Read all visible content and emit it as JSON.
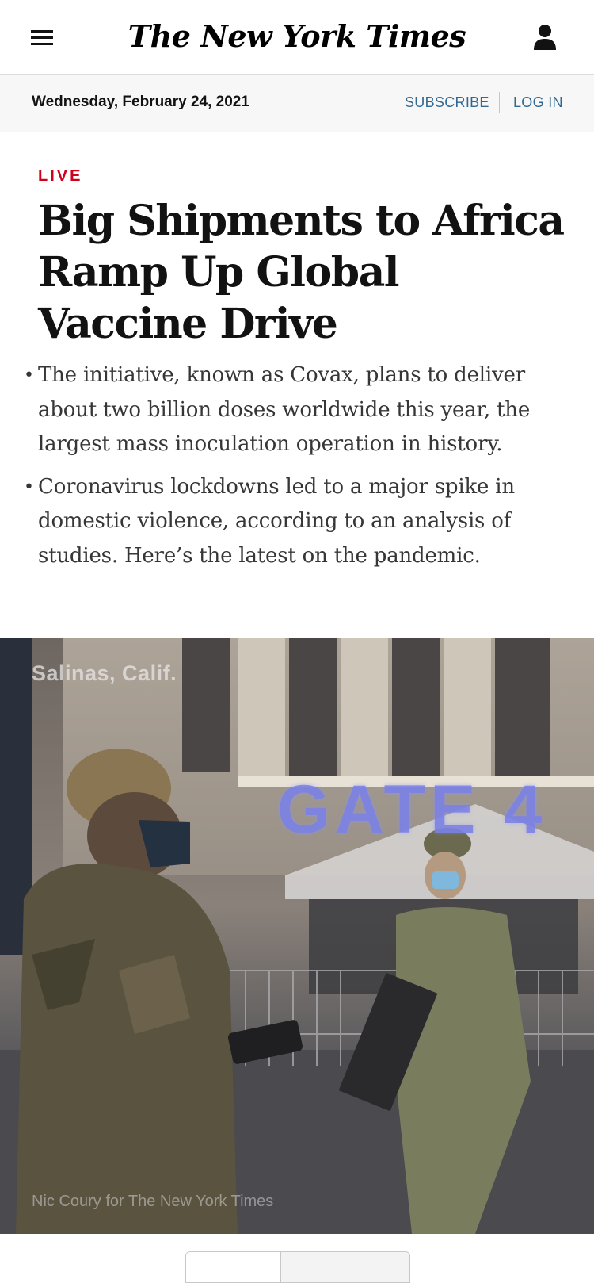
{
  "masthead": {
    "logo": "The New York Times",
    "menu_icon": "hamburger-menu-icon",
    "account_icon": "user-account-icon"
  },
  "datebar": {
    "date": "Wednesday, February 24, 2021",
    "subscribe": "SUBSCRIBE",
    "login": "LOG IN"
  },
  "article": {
    "kicker": "LIVE",
    "headline": "Big Shipments to Africa Ramp Up Global Vaccine Drive",
    "summary": [
      "The initiative, known as Covax, plans to deliver about two billion doses worldwide this year, the largest mass inoculation operation in history.",
      "Coronavirus lockdowns led to a major spike in domestic violence, according to an analysis of studies. Here’s the latest on the pandemic."
    ],
    "bullet": "•"
  },
  "photo": {
    "location": "Salinas, Calif.",
    "sign_text": "GATE 4",
    "credit": "Nic Coury for The New York Times"
  },
  "colors": {
    "live_red": "#d0021b",
    "link_blue": "#326891",
    "text": "#121212",
    "summary_text": "#363636"
  }
}
